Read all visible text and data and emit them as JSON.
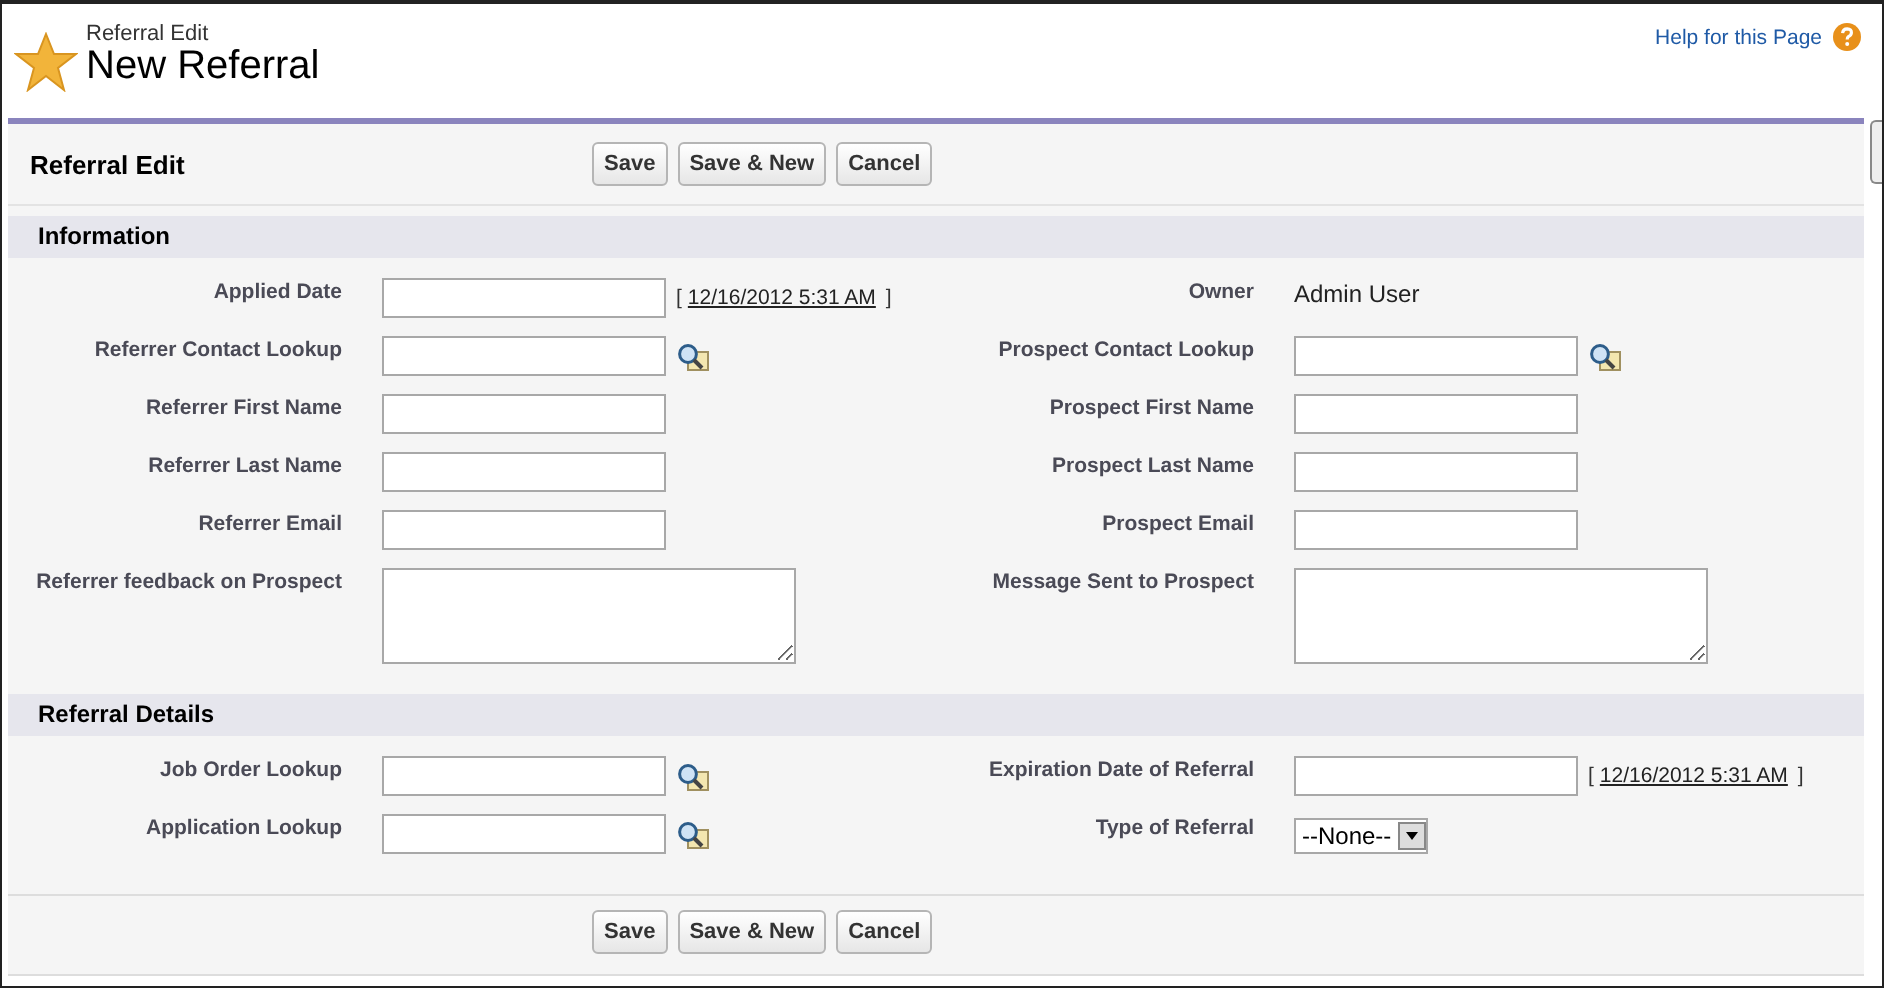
{
  "header": {
    "breadcrumb": "Referral Edit",
    "title": "New Referral",
    "help_link": "Help for this Page"
  },
  "panel": {
    "title": "Referral Edit",
    "buttons": [
      "Save",
      "Save & New",
      "Cancel"
    ]
  },
  "sections": [
    {
      "title": "Information",
      "rows": [
        [
          {
            "label": "Applied Date",
            "kind": "date",
            "link": "12/16/2012 5:31 AM",
            "open": "[",
            "close": "]"
          },
          {
            "label": "Owner",
            "kind": "readonly",
            "value": "Admin User"
          }
        ],
        [
          {
            "label": "Referrer Contact Lookup",
            "kind": "lookup"
          },
          {
            "label": "Prospect Contact Lookup",
            "kind": "lookup"
          }
        ],
        [
          {
            "label": "Referrer First Name",
            "kind": "text"
          },
          {
            "label": "Prospect First Name",
            "kind": "text"
          }
        ],
        [
          {
            "label": "Referrer Last Name",
            "kind": "text"
          },
          {
            "label": "Prospect Last Name",
            "kind": "text"
          }
        ],
        [
          {
            "label": "Referrer Email",
            "kind": "text"
          },
          {
            "label": "Prospect Email",
            "kind": "text"
          }
        ],
        [
          {
            "label": "Referrer feedback on Prospect",
            "kind": "textarea"
          },
          {
            "label": "Message Sent to Prospect",
            "kind": "textarea"
          }
        ]
      ]
    },
    {
      "title": "Referral Details",
      "rows": [
        [
          {
            "label": "Job Order Lookup",
            "kind": "lookup"
          },
          {
            "label": "Expiration Date of Referral",
            "kind": "date",
            "link": "12/16/2012 5:31 AM",
            "open": "[",
            "close": "]"
          }
        ],
        [
          {
            "label": "Application Lookup",
            "kind": "lookup"
          },
          {
            "label": "Type of Referral",
            "kind": "select",
            "value": "--None--"
          }
        ]
      ]
    }
  ],
  "footer_buttons": [
    "Save",
    "Save & New",
    "Cancel"
  ]
}
